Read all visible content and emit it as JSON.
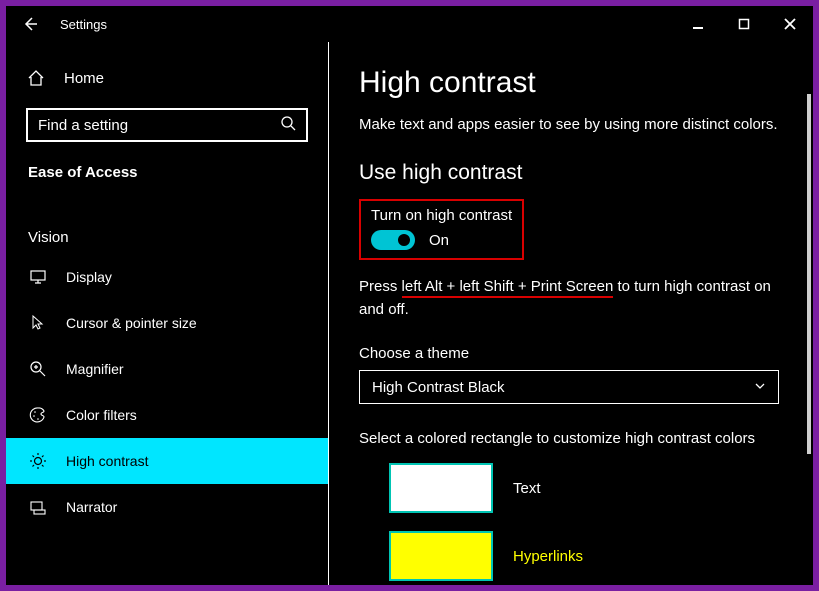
{
  "titlebar": {
    "app_title": "Settings"
  },
  "sidebar": {
    "home_label": "Home",
    "search_placeholder": "Find a setting",
    "section_header": "Ease of Access",
    "group_label": "Vision",
    "items": [
      {
        "label": "Display"
      },
      {
        "label": "Cursor & pointer size"
      },
      {
        "label": "Magnifier"
      },
      {
        "label": "Color filters"
      },
      {
        "label": "High contrast"
      },
      {
        "label": "Narrator"
      }
    ]
  },
  "main": {
    "page_title": "High contrast",
    "description": "Make text and apps easier to see by using more distinct colors.",
    "use_heading": "Use high contrast",
    "toggle_label": "Turn on high contrast",
    "toggle_state": "On",
    "hint_prefix": "Press ",
    "hint_shortcut": "left Alt + left Shift + Print Screen",
    "hint_suffix": " to turn high contrast on and off.",
    "theme_label": "Choose a theme",
    "theme_value": "High Contrast Black",
    "swatch_desc": "Select a colored rectangle to customize high contrast colors",
    "swatch1_label": "Text",
    "swatch2_label": "Hyperlinks"
  },
  "colors": {
    "accent": "#00e6ff",
    "toggle": "#00c4d4",
    "swatch_border": "#00c4b3",
    "highlight_box": "#d90000",
    "hyperlink": "#ffff00"
  }
}
